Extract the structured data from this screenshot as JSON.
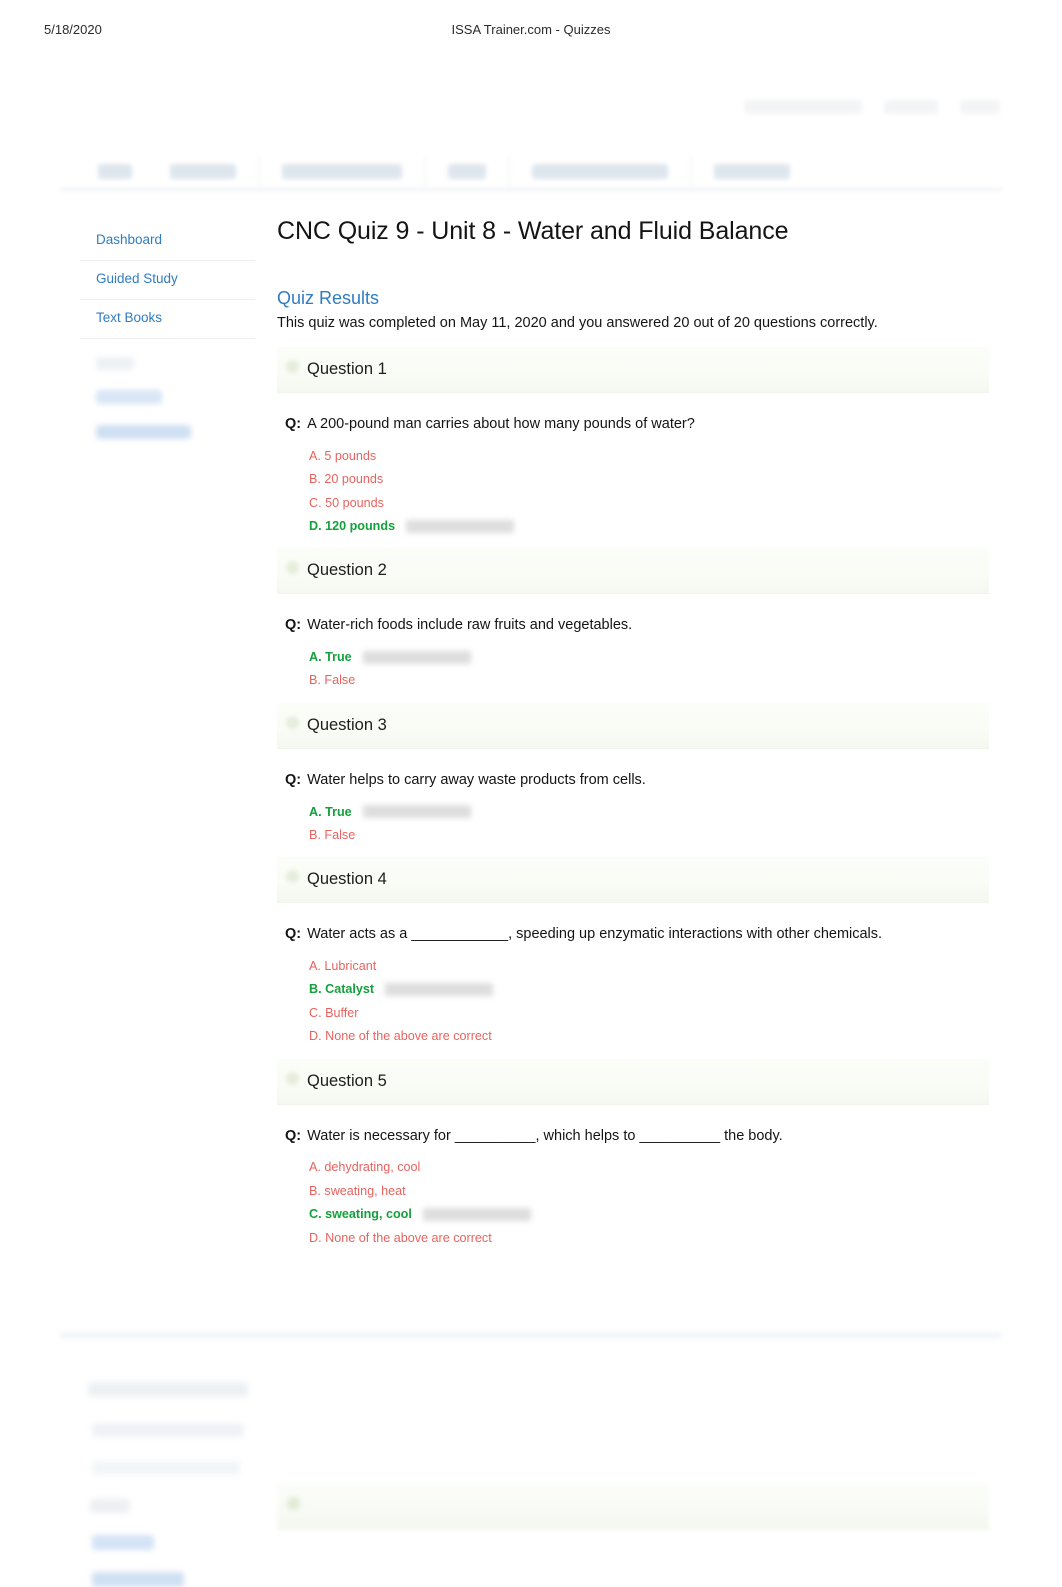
{
  "print_header": {
    "date": "5/18/2020",
    "title": "ISSA Trainer.com - Quizzes"
  },
  "sidebar": {
    "items": [
      {
        "label": "Dashboard"
      },
      {
        "label": "Guided Study"
      },
      {
        "label": "Text Books"
      }
    ]
  },
  "main": {
    "page_title": "CNC Quiz 9 - Unit 8 - Water and Fluid Balance",
    "results_heading": "Quiz Results",
    "results_summary": "This quiz was completed on May 11, 2020 and you answered 20 out of 20 questions correctly.",
    "q_tag": "Q:",
    "questions": [
      {
        "header": "Question 1",
        "prompt": "A 200-pound man carries about how many pounds of water?",
        "answers": [
          {
            "text": "A. 5 pounds",
            "correct": false
          },
          {
            "text": "B. 20 pounds",
            "correct": false
          },
          {
            "text": "C. 50 pounds",
            "correct": false
          },
          {
            "text": "D. 120 pounds",
            "correct": true
          }
        ]
      },
      {
        "header": "Question 2",
        "prompt": "Water-rich foods include raw fruits and vegetables.",
        "answers": [
          {
            "text": "A. True",
            "correct": true
          },
          {
            "text": "B. False",
            "correct": false
          }
        ]
      },
      {
        "header": "Question 3",
        "prompt": "Water helps to carry away waste products from cells.",
        "answers": [
          {
            "text": "A. True",
            "correct": true
          },
          {
            "text": "B. False",
            "correct": false
          }
        ]
      },
      {
        "header": "Question 4",
        "prompt": "Water acts as a ____________, speeding up enzymatic interactions with other chemicals.",
        "answers": [
          {
            "text": "A. Lubricant",
            "correct": false
          },
          {
            "text": "B. Catalyst",
            "correct": true
          },
          {
            "text": "C. Buffer",
            "correct": false
          },
          {
            "text": "D. None of the above are correct",
            "correct": false
          }
        ]
      },
      {
        "header": "Question 5",
        "prompt": "Water is necessary for __________, which helps to __________ the body.",
        "answers": [
          {
            "text": "A. dehydrating, cool",
            "correct": false
          },
          {
            "text": "B. sweating, heat",
            "correct": false
          },
          {
            "text": "C. sweating, cool",
            "correct": true
          },
          {
            "text": "D. None of the above are correct",
            "correct": false
          }
        ]
      }
    ]
  },
  "colors": {
    "link_blue": "#2f7cc4",
    "wrong_red": "#e8635f",
    "correct_green": "#14a03c"
  }
}
